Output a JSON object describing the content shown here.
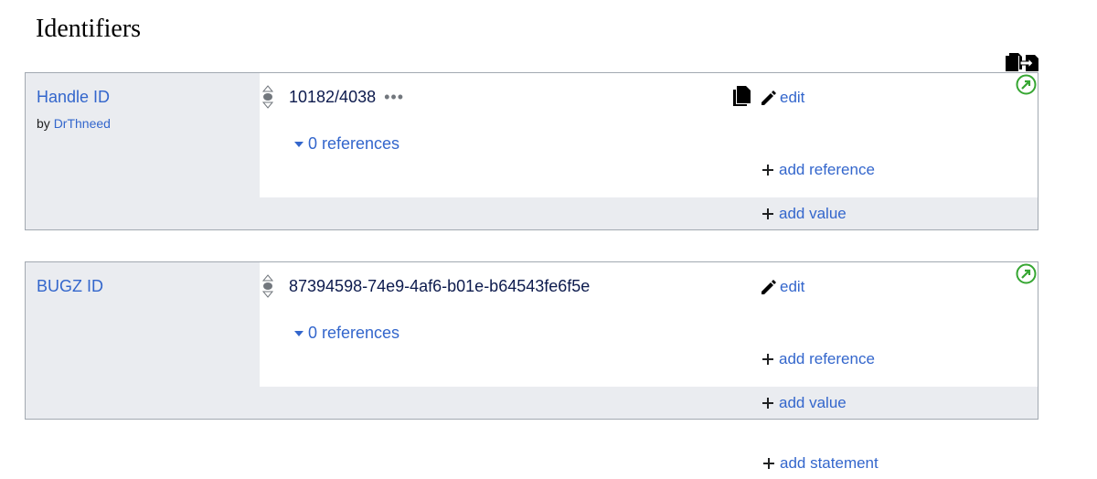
{
  "section": {
    "title": "Identifiers"
  },
  "statements": [
    {
      "property": "Handle ID",
      "byline_prefix": "by",
      "byline_user": "DrThneed",
      "value": "10182/4038",
      "value_more": "•••",
      "edit_label": "edit",
      "references_label": "0 references",
      "add_reference_label": "add reference",
      "add_value_label": "add value"
    },
    {
      "property": "BUGZ ID",
      "value": "87394598-74e9-4af6-b01e-b64543fe6f5e",
      "edit_label": "edit",
      "references_label": "0 references",
      "add_reference_label": "add reference",
      "add_value_label": "add value"
    }
  ],
  "add_statement_label": "add statement",
  "icons": {
    "copy_move": "copy-move-icon",
    "rank": "rank-normal-icon",
    "copy": "copy-icon",
    "edit": "pencil-icon",
    "external": "external-link-icon",
    "add": "plus-icon",
    "collapse": "caret-down-icon"
  },
  "colors": {
    "link": "#3366cc",
    "value": "#0c1a4d",
    "panel": "#eaecf0",
    "border": "#a2a9b1",
    "external_icon": "#36a632"
  }
}
